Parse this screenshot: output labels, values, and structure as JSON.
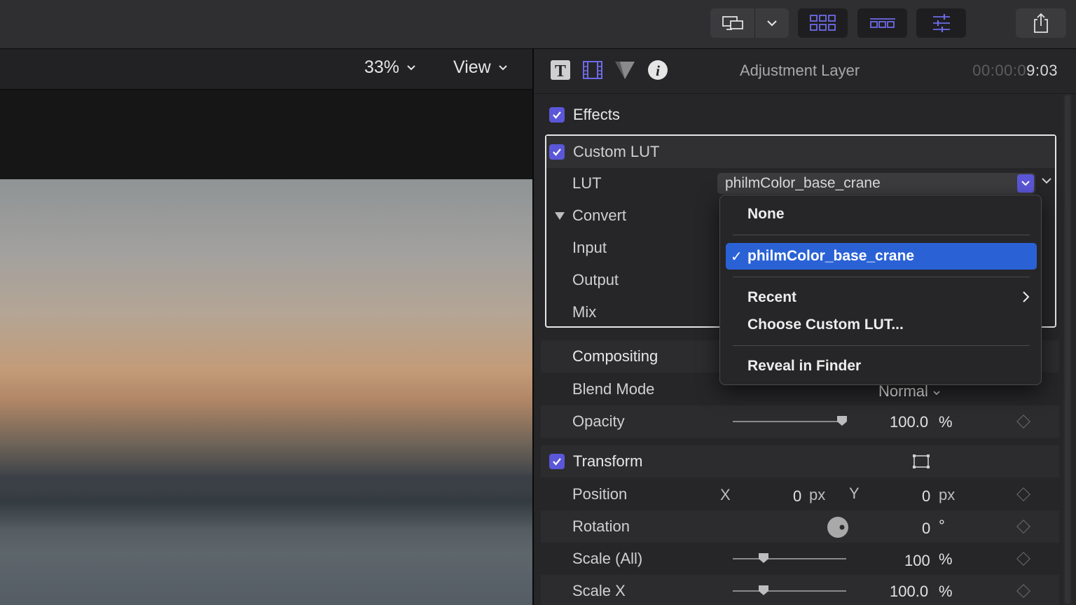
{
  "toolbar": {
    "view_options_icon": "display-icon",
    "chevron_icon": "chevron-down-icon",
    "browser_icon": "grid-icon",
    "timeline_icon": "timeline-icon",
    "inspector_icon": "sliders-icon",
    "share_icon": "share-icon",
    "accent": "#5b57d8"
  },
  "viewer": {
    "zoom": "33%",
    "view_menu": "View"
  },
  "inspector": {
    "tabs": [
      "text-icon",
      "video-icon",
      "filter-icon",
      "info-icon"
    ],
    "title": "Adjustment Layer",
    "timecode_dim": "00:00:0",
    "timecode_bright": "9:03"
  },
  "effects": {
    "header": "Effects",
    "custom_lut": {
      "header": "Custom LUT",
      "lut_label": "LUT",
      "lut_value": "philmColor_base_crane",
      "convert_label": "Convert",
      "input_label": "Input",
      "output_label": "Output",
      "mix_label": "Mix"
    }
  },
  "compositing": {
    "header": "Compositing",
    "blend_mode_label": "Blend Mode",
    "blend_mode_value": "Normal",
    "opacity_label": "Opacity",
    "opacity_value": "100.0",
    "opacity_unit": "%",
    "opacity_level": 1.0
  },
  "transform": {
    "header": "Transform",
    "position_label": "Position",
    "x_label": "X",
    "x_value": "0",
    "x_unit": "px",
    "y_label": "Y",
    "y_value": "0",
    "y_unit": "px",
    "rotation_label": "Rotation",
    "rotation_value": "0",
    "rotation_unit": "°",
    "scale_all_label": "Scale (All)",
    "scale_all_value": "100",
    "scale_all_unit": "%",
    "scale_x_label": "Scale X",
    "scale_x_value": "100.0",
    "scale_x_unit": "%"
  },
  "lut_menu": {
    "items": [
      {
        "label": "None"
      },
      {
        "label": "philmColor_base_crane",
        "checkmark": "✓"
      },
      {
        "label": "Recent"
      },
      {
        "label": "Choose Custom LUT..."
      },
      {
        "label": "Reveal in Finder"
      }
    ]
  }
}
